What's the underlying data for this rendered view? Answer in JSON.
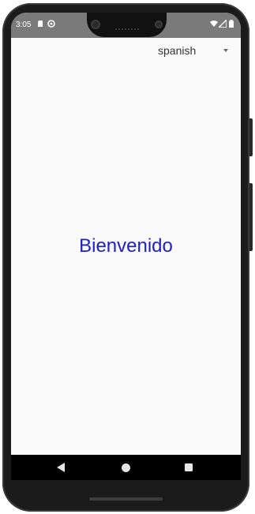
{
  "status_bar": {
    "time": "3:05",
    "left_icons": [
      "sd-card-icon",
      "sync-icon"
    ],
    "right_icons": [
      "wifi-icon",
      "cell-signal-icon",
      "battery-icon"
    ]
  },
  "language_selector": {
    "selected": "spanish"
  },
  "main": {
    "welcome_text": "Bienvenido"
  },
  "nav_bar": {
    "buttons": [
      "back-icon",
      "home-icon",
      "recents-icon"
    ]
  },
  "colors": {
    "welcome_text": "#2020c8",
    "status_bar_bg": "#7a7a7a",
    "screen_bg": "#fafafa",
    "nav_bar_bg": "#000000"
  }
}
